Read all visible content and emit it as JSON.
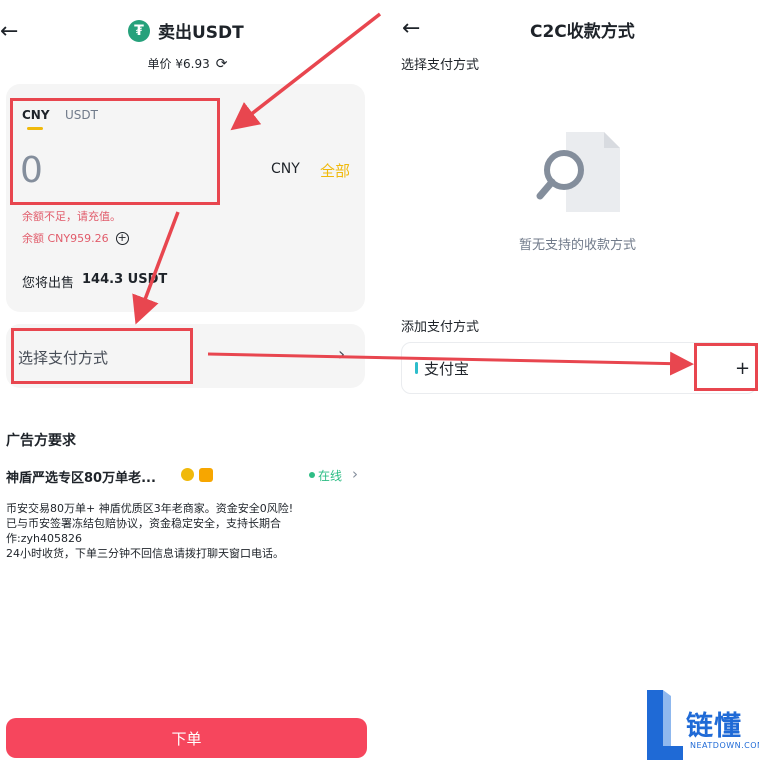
{
  "left_screen": {
    "title": "卖出USDT",
    "price_label": "单价 ¥6.93",
    "tabs": [
      "CNY",
      "USDT"
    ],
    "amount": "0",
    "currency": "CNY",
    "all_label": "全部",
    "error_text": "余额不足，请充值。",
    "balance_label": "余额 CNY959.26",
    "sell_prefix": "您将出售",
    "sell_amount": "144.3 USDT",
    "payment_placeholder": "选择支付方式",
    "advertiser_section": "广告方要求",
    "shop_name": "神盾严选专区80万单老...",
    "online_status": "在线",
    "description": [
      "币安交易80万单+ 神盾优质区3年老商家。资金安全0风险!",
      "已与币安签署冻结包赔协议，资金稳定安全，支持长期合",
      "作:zyh405826",
      "24小时收货，下单三分钟不回信息请拨打聊天窗口电话。"
    ],
    "order_button": "下单"
  },
  "right_screen": {
    "title": "C2C收款方式",
    "select_section": "选择支付方式",
    "empty_text": "暂无支持的收款方式",
    "add_section": "添加支付方式",
    "alipay_label": "支付宝",
    "add_icon": "+"
  },
  "watermark": {
    "name": "链懂",
    "sub": "NEATDOWN.COM"
  },
  "colors": {
    "accent_yellow": "#f0b90b",
    "sell_red": "#f6465d",
    "annotation_red": "#e8464f",
    "online_green": "#2ebd85",
    "brand_blue": "#1f6ad6"
  },
  "icons": [
    "back-arrow-icon",
    "usdt-logo-icon",
    "refresh-icon",
    "plus-circle-icon",
    "chevron-right-icon",
    "empty-search-icon",
    "plus-icon"
  ]
}
